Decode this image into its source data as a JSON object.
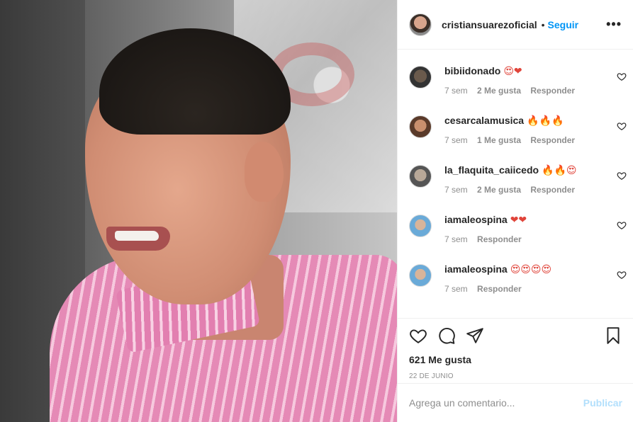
{
  "post": {
    "username": "cristiansuarezoficial",
    "separator": "•",
    "follow_label": "Seguir",
    "more_label": "•••"
  },
  "comments": [
    {
      "user": "bibiidonado",
      "text": "😍❤",
      "time": "7 sem",
      "likes": "2 Me gusta",
      "reply": "Responder"
    },
    {
      "user": "cesarcalamusica",
      "text": "🔥🔥🔥",
      "time": "7 sem",
      "likes": "1 Me gusta",
      "reply": "Responder"
    },
    {
      "user": "la_flaquita_caiicedo",
      "text": "🔥🔥😍",
      "time": "7 sem",
      "likes": "2 Me gusta",
      "reply": "Responder"
    },
    {
      "user": "iamaleospina",
      "text": "❤❤",
      "time": "7 sem",
      "likes": "",
      "reply": "Responder"
    },
    {
      "user": "iamaleospina",
      "text": "😍😍😍😍",
      "time": "7 sem",
      "likes": "",
      "reply": "Responder"
    }
  ],
  "footer": {
    "likes_count": "621 Me gusta",
    "date": "22 DE JUNIO"
  },
  "add_comment": {
    "placeholder": "Agrega un comentario...",
    "publish_label": "Publicar"
  },
  "colors": {
    "accent": "#0095f6",
    "publish_disabled": "#b2dffc",
    "border": "#efefef",
    "muted_text": "#8e8e8e"
  }
}
